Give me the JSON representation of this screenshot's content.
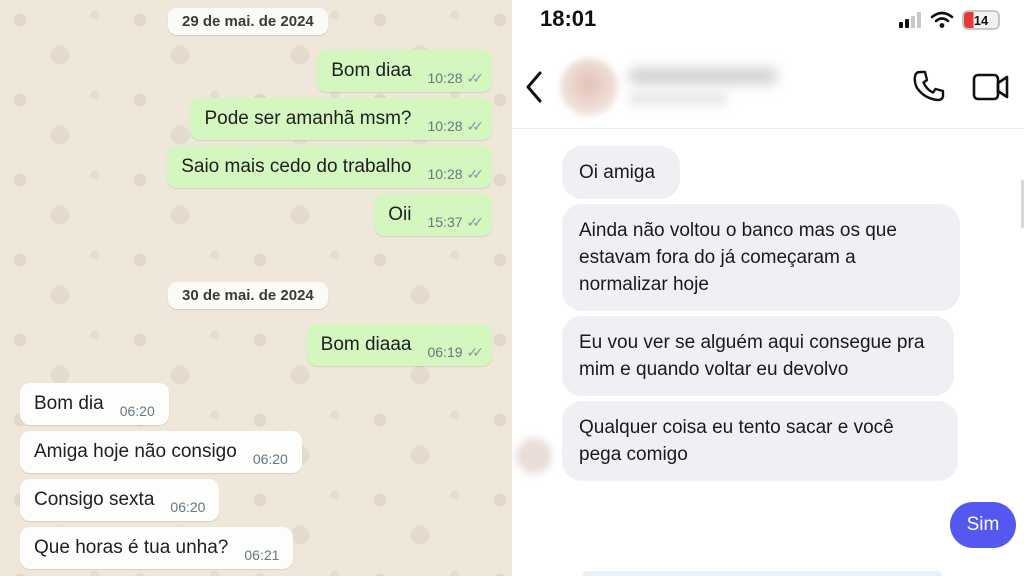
{
  "whatsapp": {
    "date1": "29 de mai. de 2024",
    "date2": "30 de mai. de 2024",
    "out_msgs": [
      {
        "text": "Bom diaa",
        "time": "10:28"
      },
      {
        "text": "Pode ser amanhã msm?",
        "time": "10:28"
      },
      {
        "text": "Saio mais cedo do trabalho",
        "time": "10:28"
      },
      {
        "text": "Oii",
        "time": "15:37"
      },
      {
        "text": "Bom diaaa",
        "time": "06:19"
      }
    ],
    "in_msgs": [
      {
        "text": "Bom dia",
        "time": "06:20"
      },
      {
        "text": "Amiga hoje não consigo",
        "time": "06:20"
      },
      {
        "text": "Consigo sexta",
        "time": "06:20"
      },
      {
        "text": "Que horas é tua unha?",
        "time": "06:21"
      }
    ],
    "colors": {
      "outgoing": "#d4f7c0",
      "incoming": "#fdfdfc",
      "background": "#efe7da"
    }
  },
  "imessage": {
    "status_time": "18:01",
    "battery": "14",
    "in_msgs": [
      "Oi amiga",
      "Ainda não voltou o banco mas os que estavam fora do já começaram a normalizar hoje",
      "Eu vou ver se alguém aqui consegue pra mim e quando voltar eu devolvo",
      "Qualquer coisa eu tento sacar e você pega comigo"
    ],
    "out_msg": "Sim",
    "icons": [
      "back-chevron-icon",
      "phone-icon",
      "video-icon",
      "signal-icon",
      "wifi-icon",
      "battery-icon"
    ],
    "colors": {
      "incoming": "#eef0f3",
      "outgoing": "#5458f0",
      "battery_low": "#e53935"
    }
  }
}
